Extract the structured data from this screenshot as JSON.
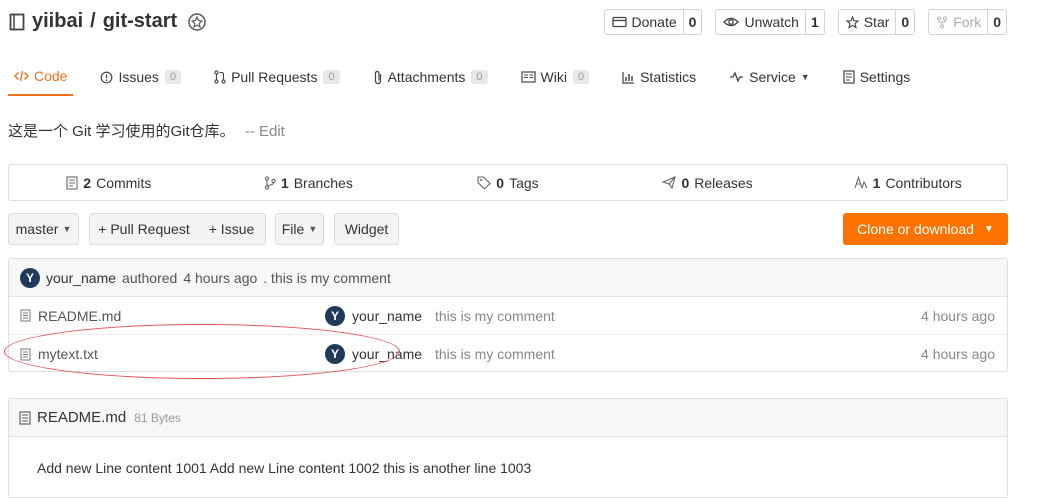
{
  "repo": {
    "owner": "yiibai",
    "separator": "/",
    "name": "git-start"
  },
  "header_actions": [
    {
      "label": "Donate",
      "count": "0",
      "icon": "donate-icon"
    },
    {
      "label": "Unwatch",
      "count": "1",
      "icon": "eye-icon"
    },
    {
      "label": "Star",
      "count": "0",
      "icon": "star-icon"
    },
    {
      "label": "Fork",
      "count": "0",
      "icon": "fork-icon",
      "disabled": true
    }
  ],
  "tabs": [
    {
      "label": "Code",
      "icon": "code-icon",
      "active": true
    },
    {
      "label": "Issues",
      "count": "0",
      "icon": "issue-icon"
    },
    {
      "label": "Pull Requests",
      "count": "0",
      "icon": "pull-request-icon"
    },
    {
      "label": "Attachments",
      "count": "0",
      "icon": "paperclip-icon"
    },
    {
      "label": "Wiki",
      "count": "0",
      "icon": "wiki-icon"
    },
    {
      "label": "Statistics",
      "icon": "statistics-icon"
    },
    {
      "label": "Service",
      "icon": "pulse-icon",
      "dropdown": true
    },
    {
      "label": "Settings",
      "icon": "settings-icon"
    }
  ],
  "description": {
    "text": "这是一个 Git 学习使用的Git仓库。",
    "edit_label": "-- Edit"
  },
  "stats": [
    {
      "count": "2",
      "label": "Commits",
      "icon": "commit-icon"
    },
    {
      "count": "1",
      "label": "Branches",
      "icon": "branch-icon"
    },
    {
      "count": "0",
      "label": "Tags",
      "icon": "tag-icon"
    },
    {
      "count": "0",
      "label": "Releases",
      "icon": "release-icon"
    },
    {
      "count": "1",
      "label": "Contributors",
      "icon": "contributors-icon"
    }
  ],
  "toolbar": {
    "branch": "master",
    "pull_request": "+ Pull Request",
    "issue": "+ Issue",
    "file": "File",
    "widget": "Widget",
    "clone": "Clone or download"
  },
  "last_commit": {
    "avatar": "Y",
    "author": "your_name",
    "action": "authored",
    "time": "4 hours ago",
    "message": ". this is my comment"
  },
  "files": [
    {
      "name": "README.md",
      "avatar": "Y",
      "author": "your_name",
      "message": "this is my comment",
      "time": "4 hours ago"
    },
    {
      "name": "mytext.txt",
      "avatar": "Y",
      "author": "your_name",
      "message": "this is my comment",
      "time": "4 hours ago"
    }
  ],
  "readme": {
    "title": "README.md",
    "size": "81 Bytes",
    "content": "Add new Line content 1001 Add new Line content 1002 this is another line 1003"
  },
  "colors": {
    "accent": "#f2711c",
    "clone_button": "#fe7300",
    "annotation": "#e05555"
  }
}
